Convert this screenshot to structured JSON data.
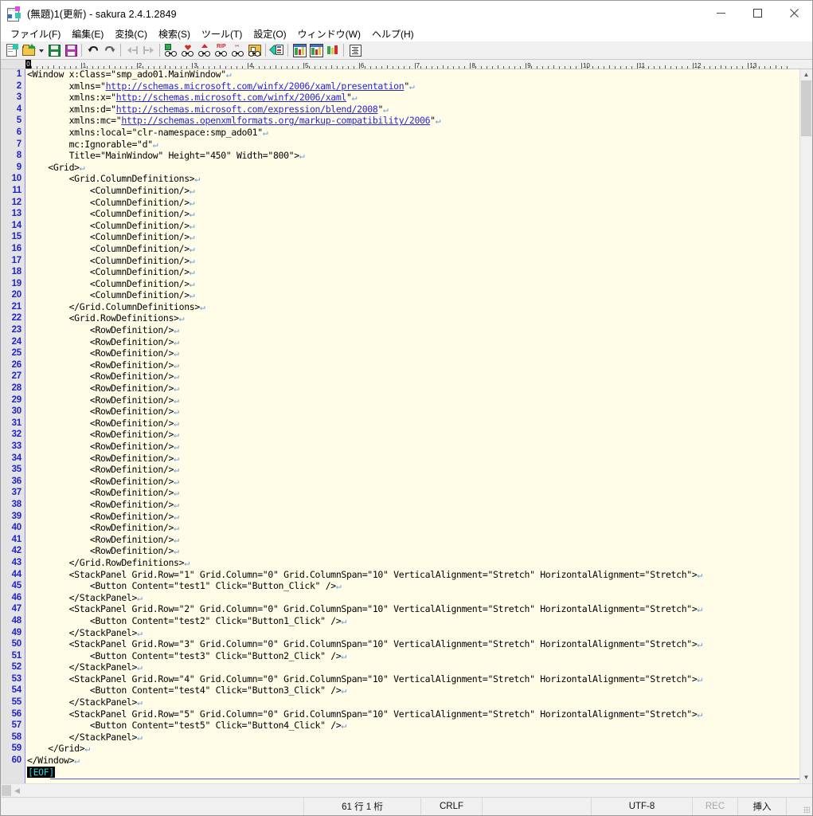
{
  "window": {
    "title": "(無題)1(更新) - sakura 2.4.1.2849",
    "icon": "sakura-notepad-icon",
    "controls": {
      "minimize": "minimize-icon",
      "maximize": "maximize-icon",
      "close": "close-icon"
    }
  },
  "menubar": [
    {
      "label": "ファイル(F)",
      "name": "menu-file"
    },
    {
      "label": "編集(E)",
      "name": "menu-edit"
    },
    {
      "label": "変換(C)",
      "name": "menu-convert"
    },
    {
      "label": "検索(S)",
      "name": "menu-search"
    },
    {
      "label": "ツール(T)",
      "name": "menu-tools"
    },
    {
      "label": "設定(O)",
      "name": "menu-settings"
    },
    {
      "label": "ウィンドウ(W)",
      "name": "menu-window"
    },
    {
      "label": "ヘルプ(H)",
      "name": "menu-help"
    }
  ],
  "toolbar": [
    {
      "name": "new-file-icon"
    },
    {
      "name": "open-file-icon"
    },
    {
      "name": "open-history-dropdown-icon"
    },
    {
      "name": "save-icon"
    },
    {
      "name": "save-as-icon"
    },
    {
      "name": "undo-icon"
    },
    {
      "name": "redo-icon"
    },
    {
      "name": "move-left-icon"
    },
    {
      "name": "move-right-icon"
    },
    {
      "name": "search-icon"
    },
    {
      "name": "search-next-icon"
    },
    {
      "name": "search-prev-icon"
    },
    {
      "name": "replace-icon"
    },
    {
      "name": "grep-icon"
    },
    {
      "name": "grep-replace-icon"
    },
    {
      "name": "bookmark-icon"
    },
    {
      "name": "tile-horizontal-icon"
    },
    {
      "name": "tile-vertical-icon"
    },
    {
      "name": "cascade-icon"
    },
    {
      "name": "outline-icon"
    }
  ],
  "ruler": {
    "caret_column_label": "0",
    "numbers": [
      "1",
      "2",
      "3",
      "4",
      "5",
      "6",
      "7",
      "8",
      "9",
      "10",
      "11",
      "12",
      "13"
    ]
  },
  "editor": {
    "char_width": 6.98,
    "cr_glyph": "↵",
    "eof_marker": "[EOF]",
    "lines": [
      {
        "n": 1,
        "segments": [
          {
            "t": "<Window x:Class=\"smp_ado01.MainWindow\""
          }
        ]
      },
      {
        "n": 2,
        "segments": [
          {
            "t": "        xmlns=\""
          },
          {
            "t": "http://schemas.microsoft.com/winfx/2006/xaml/presentation",
            "k": "lnk"
          },
          {
            "t": "\""
          }
        ]
      },
      {
        "n": 3,
        "segments": [
          {
            "t": "        xmlns:x=\""
          },
          {
            "t": "http://schemas.microsoft.com/winfx/2006/xaml",
            "k": "lnk"
          },
          {
            "t": "\""
          }
        ]
      },
      {
        "n": 4,
        "segments": [
          {
            "t": "        xmlns:d=\""
          },
          {
            "t": "http://schemas.microsoft.com/expression/blend/2008",
            "k": "lnk"
          },
          {
            "t": "\""
          }
        ]
      },
      {
        "n": 5,
        "segments": [
          {
            "t": "        xmlns:mc=\""
          },
          {
            "t": "http://schemas.openxmlformats.org/markup-compatibility/2006",
            "k": "lnk"
          },
          {
            "t": "\""
          }
        ]
      },
      {
        "n": 6,
        "segments": [
          {
            "t": "        xmlns:local=\"clr-namespace:smp_ado01\""
          }
        ]
      },
      {
        "n": 7,
        "segments": [
          {
            "t": "        mc:Ignorable=\"d\""
          }
        ]
      },
      {
        "n": 8,
        "segments": [
          {
            "t": "        Title=\"MainWindow\" Height=\"450\" Width=\"800\">"
          }
        ]
      },
      {
        "n": 9,
        "segments": [
          {
            "t": "    <Grid>"
          }
        ]
      },
      {
        "n": 10,
        "segments": [
          {
            "t": "        <Grid.ColumnDefinitions>"
          }
        ]
      },
      {
        "n": 11,
        "segments": [
          {
            "t": "            <ColumnDefinition/>"
          }
        ]
      },
      {
        "n": 12,
        "segments": [
          {
            "t": "            <ColumnDefinition/>"
          }
        ]
      },
      {
        "n": 13,
        "segments": [
          {
            "t": "            <ColumnDefinition/>"
          }
        ]
      },
      {
        "n": 14,
        "segments": [
          {
            "t": "            <ColumnDefinition/>"
          }
        ]
      },
      {
        "n": 15,
        "segments": [
          {
            "t": "            <ColumnDefinition/>"
          }
        ]
      },
      {
        "n": 16,
        "segments": [
          {
            "t": "            <ColumnDefinition/>"
          }
        ]
      },
      {
        "n": 17,
        "segments": [
          {
            "t": "            <ColumnDefinition/>"
          }
        ]
      },
      {
        "n": 18,
        "segments": [
          {
            "t": "            <ColumnDefinition/>"
          }
        ]
      },
      {
        "n": 19,
        "segments": [
          {
            "t": "            <ColumnDefinition/>"
          }
        ]
      },
      {
        "n": 20,
        "segments": [
          {
            "t": "            <ColumnDefinition/>"
          }
        ]
      },
      {
        "n": 21,
        "segments": [
          {
            "t": "        </Grid.ColumnDefinitions>"
          }
        ]
      },
      {
        "n": 22,
        "segments": [
          {
            "t": "        <Grid.RowDefinitions>"
          }
        ]
      },
      {
        "n": 23,
        "segments": [
          {
            "t": "            <RowDefinition/>"
          }
        ]
      },
      {
        "n": 24,
        "segments": [
          {
            "t": "            <RowDefinition/>"
          }
        ]
      },
      {
        "n": 25,
        "segments": [
          {
            "t": "            <RowDefinition/>"
          }
        ]
      },
      {
        "n": 26,
        "segments": [
          {
            "t": "            <RowDefinition/>"
          }
        ]
      },
      {
        "n": 27,
        "segments": [
          {
            "t": "            <RowDefinition/>"
          }
        ]
      },
      {
        "n": 28,
        "segments": [
          {
            "t": "            <RowDefinition/>"
          }
        ]
      },
      {
        "n": 29,
        "segments": [
          {
            "t": "            <RowDefinition/>"
          }
        ]
      },
      {
        "n": 30,
        "segments": [
          {
            "t": "            <RowDefinition/>"
          }
        ]
      },
      {
        "n": 31,
        "segments": [
          {
            "t": "            <RowDefinition/>"
          }
        ]
      },
      {
        "n": 32,
        "segments": [
          {
            "t": "            <RowDefinition/>"
          }
        ]
      },
      {
        "n": 33,
        "segments": [
          {
            "t": "            <RowDefinition/>"
          }
        ]
      },
      {
        "n": 34,
        "segments": [
          {
            "t": "            <RowDefinition/>"
          }
        ]
      },
      {
        "n": 35,
        "segments": [
          {
            "t": "            <RowDefinition/>"
          }
        ]
      },
      {
        "n": 36,
        "segments": [
          {
            "t": "            <RowDefinition/>"
          }
        ]
      },
      {
        "n": 37,
        "segments": [
          {
            "t": "            <RowDefinition/>"
          }
        ]
      },
      {
        "n": 38,
        "segments": [
          {
            "t": "            <RowDefinition/>"
          }
        ]
      },
      {
        "n": 39,
        "segments": [
          {
            "t": "            <RowDefinition/>"
          }
        ]
      },
      {
        "n": 40,
        "segments": [
          {
            "t": "            <RowDefinition/>"
          }
        ]
      },
      {
        "n": 41,
        "segments": [
          {
            "t": "            <RowDefinition/>"
          }
        ]
      },
      {
        "n": 42,
        "segments": [
          {
            "t": "            <RowDefinition/>"
          }
        ]
      },
      {
        "n": 43,
        "segments": [
          {
            "t": "        </Grid.RowDefinitions>"
          }
        ]
      },
      {
        "n": 44,
        "segments": [
          {
            "t": "        <StackPanel Grid.Row=\"1\" Grid.Column=\"0\" Grid.ColumnSpan=\"10\" VerticalAlignment=\"Stretch\" HorizontalAlignment=\"Stretch\">"
          }
        ]
      },
      {
        "n": 45,
        "segments": [
          {
            "t": "            <Button Content=\"test1\" Click=\"Button_Click\" />"
          }
        ]
      },
      {
        "n": 46,
        "segments": [
          {
            "t": "        </StackPanel>"
          }
        ]
      },
      {
        "n": 47,
        "segments": [
          {
            "t": "        <StackPanel Grid.Row=\"2\" Grid.Column=\"0\" Grid.ColumnSpan=\"10\" VerticalAlignment=\"Stretch\" HorizontalAlignment=\"Stretch\">"
          }
        ]
      },
      {
        "n": 48,
        "segments": [
          {
            "t": "            <Button Content=\"test2\" Click=\"Button1_Click\" />"
          }
        ]
      },
      {
        "n": 49,
        "segments": [
          {
            "t": "        </StackPanel>"
          }
        ]
      },
      {
        "n": 50,
        "segments": [
          {
            "t": "        <StackPanel Grid.Row=\"3\" Grid.Column=\"0\" Grid.ColumnSpan=\"10\" VerticalAlignment=\"Stretch\" HorizontalAlignment=\"Stretch\">"
          }
        ]
      },
      {
        "n": 51,
        "segments": [
          {
            "t": "            <Button Content=\"test3\" Click=\"Button2_Click\" />"
          }
        ]
      },
      {
        "n": 52,
        "segments": [
          {
            "t": "        </StackPanel>"
          }
        ]
      },
      {
        "n": 53,
        "segments": [
          {
            "t": "        <StackPanel Grid.Row=\"4\" Grid.Column=\"0\" Grid.ColumnSpan=\"10\" VerticalAlignment=\"Stretch\" HorizontalAlignment=\"Stretch\">"
          }
        ]
      },
      {
        "n": 54,
        "segments": [
          {
            "t": "            <Button Content=\"test4\" Click=\"Button3_Click\" />"
          }
        ]
      },
      {
        "n": 55,
        "segments": [
          {
            "t": "        </StackPanel>"
          }
        ]
      },
      {
        "n": 56,
        "segments": [
          {
            "t": "        <StackPanel Grid.Row=\"5\" Grid.Column=\"0\" Grid.ColumnSpan=\"10\" VerticalAlignment=\"Stretch\" HorizontalAlignment=\"Stretch\">"
          }
        ]
      },
      {
        "n": 57,
        "segments": [
          {
            "t": "            <Button Content=\"test5\" Click=\"Button4_Click\" />"
          }
        ]
      },
      {
        "n": 58,
        "segments": [
          {
            "t": "        </StackPanel>"
          }
        ]
      },
      {
        "n": 59,
        "segments": [
          {
            "t": "    </Grid>"
          }
        ]
      },
      {
        "n": 60,
        "segments": [
          {
            "t": "</Window>"
          }
        ]
      }
    ]
  },
  "statusbar": {
    "position": "61 行  1 桁",
    "eol": "CRLF",
    "blank": "",
    "encoding": "UTF-8",
    "rec": "REC",
    "insert_mode": "挿入"
  },
  "colors": {
    "linenumber": "#2222cc",
    "link": "#2626d6",
    "cr_mark": "#5a9ad6",
    "editor_bg": "#fffce8",
    "gutter_bg": "#e3e3e3",
    "eof_bg": "#000000",
    "eof_fg": "#29d6d6"
  }
}
